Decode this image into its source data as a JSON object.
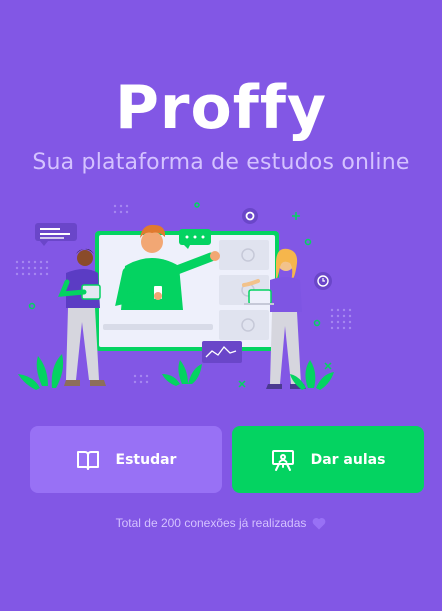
{
  "brand": {
    "name": "Proffy",
    "tagline": "Sua plataforma de estudos online"
  },
  "actions": {
    "study_label": "Estudar",
    "teach_label": "Dar aulas"
  },
  "footer": {
    "total_connections": "Total de 200 conexões já realizadas"
  },
  "colors": {
    "background": "#8257e5",
    "study_button": "#9871f5",
    "teach_button": "#04d361",
    "tagline": "#d4c2ff"
  },
  "icons": {
    "study": "open-book-icon",
    "teach": "presentation-board-icon",
    "footer": "purple-heart-icon"
  }
}
